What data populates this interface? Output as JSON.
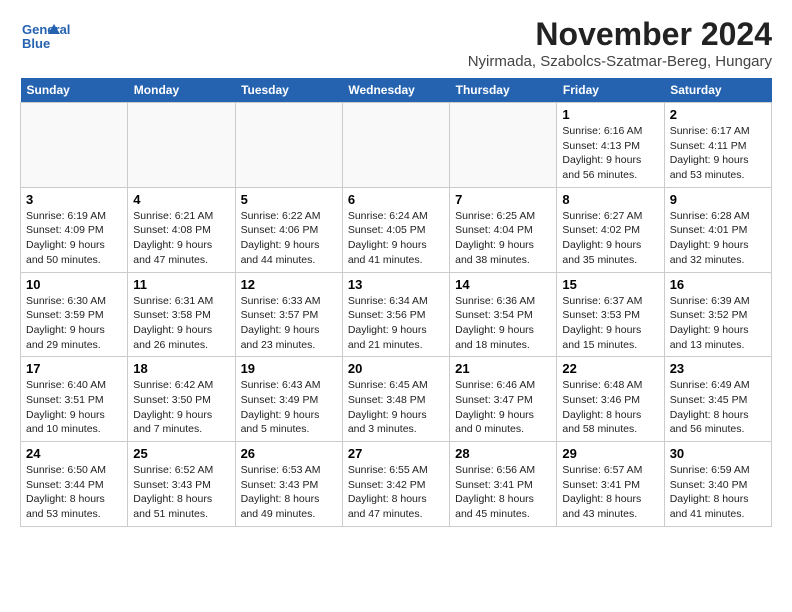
{
  "header": {
    "logo_line1": "General",
    "logo_line2": "Blue",
    "month": "November 2024",
    "location": "Nyirmada, Szabolcs-Szatmar-Bereg, Hungary"
  },
  "weekdays": [
    "Sunday",
    "Monday",
    "Tuesday",
    "Wednesday",
    "Thursday",
    "Friday",
    "Saturday"
  ],
  "weeks": [
    [
      {
        "day": "",
        "info": ""
      },
      {
        "day": "",
        "info": ""
      },
      {
        "day": "",
        "info": ""
      },
      {
        "day": "",
        "info": ""
      },
      {
        "day": "",
        "info": ""
      },
      {
        "day": "1",
        "info": "Sunrise: 6:16 AM\nSunset: 4:13 PM\nDaylight: 9 hours\nand 56 minutes."
      },
      {
        "day": "2",
        "info": "Sunrise: 6:17 AM\nSunset: 4:11 PM\nDaylight: 9 hours\nand 53 minutes."
      }
    ],
    [
      {
        "day": "3",
        "info": "Sunrise: 6:19 AM\nSunset: 4:09 PM\nDaylight: 9 hours\nand 50 minutes."
      },
      {
        "day": "4",
        "info": "Sunrise: 6:21 AM\nSunset: 4:08 PM\nDaylight: 9 hours\nand 47 minutes."
      },
      {
        "day": "5",
        "info": "Sunrise: 6:22 AM\nSunset: 4:06 PM\nDaylight: 9 hours\nand 44 minutes."
      },
      {
        "day": "6",
        "info": "Sunrise: 6:24 AM\nSunset: 4:05 PM\nDaylight: 9 hours\nand 41 minutes."
      },
      {
        "day": "7",
        "info": "Sunrise: 6:25 AM\nSunset: 4:04 PM\nDaylight: 9 hours\nand 38 minutes."
      },
      {
        "day": "8",
        "info": "Sunrise: 6:27 AM\nSunset: 4:02 PM\nDaylight: 9 hours\nand 35 minutes."
      },
      {
        "day": "9",
        "info": "Sunrise: 6:28 AM\nSunset: 4:01 PM\nDaylight: 9 hours\nand 32 minutes."
      }
    ],
    [
      {
        "day": "10",
        "info": "Sunrise: 6:30 AM\nSunset: 3:59 PM\nDaylight: 9 hours\nand 29 minutes."
      },
      {
        "day": "11",
        "info": "Sunrise: 6:31 AM\nSunset: 3:58 PM\nDaylight: 9 hours\nand 26 minutes."
      },
      {
        "day": "12",
        "info": "Sunrise: 6:33 AM\nSunset: 3:57 PM\nDaylight: 9 hours\nand 23 minutes."
      },
      {
        "day": "13",
        "info": "Sunrise: 6:34 AM\nSunset: 3:56 PM\nDaylight: 9 hours\nand 21 minutes."
      },
      {
        "day": "14",
        "info": "Sunrise: 6:36 AM\nSunset: 3:54 PM\nDaylight: 9 hours\nand 18 minutes."
      },
      {
        "day": "15",
        "info": "Sunrise: 6:37 AM\nSunset: 3:53 PM\nDaylight: 9 hours\nand 15 minutes."
      },
      {
        "day": "16",
        "info": "Sunrise: 6:39 AM\nSunset: 3:52 PM\nDaylight: 9 hours\nand 13 minutes."
      }
    ],
    [
      {
        "day": "17",
        "info": "Sunrise: 6:40 AM\nSunset: 3:51 PM\nDaylight: 9 hours\nand 10 minutes."
      },
      {
        "day": "18",
        "info": "Sunrise: 6:42 AM\nSunset: 3:50 PM\nDaylight: 9 hours\nand 7 minutes."
      },
      {
        "day": "19",
        "info": "Sunrise: 6:43 AM\nSunset: 3:49 PM\nDaylight: 9 hours\nand 5 minutes."
      },
      {
        "day": "20",
        "info": "Sunrise: 6:45 AM\nSunset: 3:48 PM\nDaylight: 9 hours\nand 3 minutes."
      },
      {
        "day": "21",
        "info": "Sunrise: 6:46 AM\nSunset: 3:47 PM\nDaylight: 9 hours\nand 0 minutes."
      },
      {
        "day": "22",
        "info": "Sunrise: 6:48 AM\nSunset: 3:46 PM\nDaylight: 8 hours\nand 58 minutes."
      },
      {
        "day": "23",
        "info": "Sunrise: 6:49 AM\nSunset: 3:45 PM\nDaylight: 8 hours\nand 56 minutes."
      }
    ],
    [
      {
        "day": "24",
        "info": "Sunrise: 6:50 AM\nSunset: 3:44 PM\nDaylight: 8 hours\nand 53 minutes."
      },
      {
        "day": "25",
        "info": "Sunrise: 6:52 AM\nSunset: 3:43 PM\nDaylight: 8 hours\nand 51 minutes."
      },
      {
        "day": "26",
        "info": "Sunrise: 6:53 AM\nSunset: 3:43 PM\nDaylight: 8 hours\nand 49 minutes."
      },
      {
        "day": "27",
        "info": "Sunrise: 6:55 AM\nSunset: 3:42 PM\nDaylight: 8 hours\nand 47 minutes."
      },
      {
        "day": "28",
        "info": "Sunrise: 6:56 AM\nSunset: 3:41 PM\nDaylight: 8 hours\nand 45 minutes."
      },
      {
        "day": "29",
        "info": "Sunrise: 6:57 AM\nSunset: 3:41 PM\nDaylight: 8 hours\nand 43 minutes."
      },
      {
        "day": "30",
        "info": "Sunrise: 6:59 AM\nSunset: 3:40 PM\nDaylight: 8 hours\nand 41 minutes."
      }
    ]
  ]
}
